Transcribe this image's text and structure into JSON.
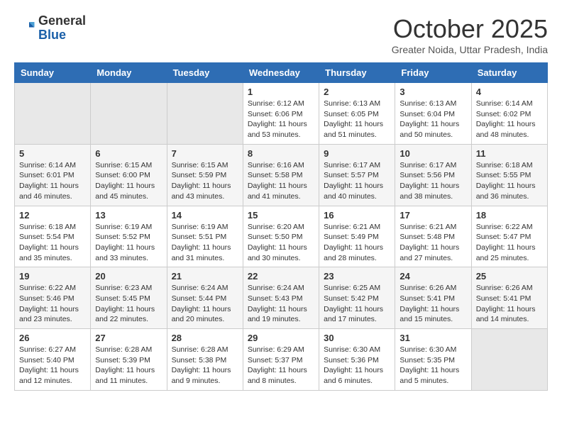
{
  "header": {
    "logo_general": "General",
    "logo_blue": "Blue",
    "month_title": "October 2025",
    "subtitle": "Greater Noida, Uttar Pradesh, India"
  },
  "days_of_week": [
    "Sunday",
    "Monday",
    "Tuesday",
    "Wednesday",
    "Thursday",
    "Friday",
    "Saturday"
  ],
  "weeks": [
    [
      {
        "day": "",
        "info": ""
      },
      {
        "day": "",
        "info": ""
      },
      {
        "day": "",
        "info": ""
      },
      {
        "day": "1",
        "info": "Sunrise: 6:12 AM\nSunset: 6:06 PM\nDaylight: 11 hours\nand 53 minutes."
      },
      {
        "day": "2",
        "info": "Sunrise: 6:13 AM\nSunset: 6:05 PM\nDaylight: 11 hours\nand 51 minutes."
      },
      {
        "day": "3",
        "info": "Sunrise: 6:13 AM\nSunset: 6:04 PM\nDaylight: 11 hours\nand 50 minutes."
      },
      {
        "day": "4",
        "info": "Sunrise: 6:14 AM\nSunset: 6:02 PM\nDaylight: 11 hours\nand 48 minutes."
      }
    ],
    [
      {
        "day": "5",
        "info": "Sunrise: 6:14 AM\nSunset: 6:01 PM\nDaylight: 11 hours\nand 46 minutes."
      },
      {
        "day": "6",
        "info": "Sunrise: 6:15 AM\nSunset: 6:00 PM\nDaylight: 11 hours\nand 45 minutes."
      },
      {
        "day": "7",
        "info": "Sunrise: 6:15 AM\nSunset: 5:59 PM\nDaylight: 11 hours\nand 43 minutes."
      },
      {
        "day": "8",
        "info": "Sunrise: 6:16 AM\nSunset: 5:58 PM\nDaylight: 11 hours\nand 41 minutes."
      },
      {
        "day": "9",
        "info": "Sunrise: 6:17 AM\nSunset: 5:57 PM\nDaylight: 11 hours\nand 40 minutes."
      },
      {
        "day": "10",
        "info": "Sunrise: 6:17 AM\nSunset: 5:56 PM\nDaylight: 11 hours\nand 38 minutes."
      },
      {
        "day": "11",
        "info": "Sunrise: 6:18 AM\nSunset: 5:55 PM\nDaylight: 11 hours\nand 36 minutes."
      }
    ],
    [
      {
        "day": "12",
        "info": "Sunrise: 6:18 AM\nSunset: 5:54 PM\nDaylight: 11 hours\nand 35 minutes."
      },
      {
        "day": "13",
        "info": "Sunrise: 6:19 AM\nSunset: 5:52 PM\nDaylight: 11 hours\nand 33 minutes."
      },
      {
        "day": "14",
        "info": "Sunrise: 6:19 AM\nSunset: 5:51 PM\nDaylight: 11 hours\nand 31 minutes."
      },
      {
        "day": "15",
        "info": "Sunrise: 6:20 AM\nSunset: 5:50 PM\nDaylight: 11 hours\nand 30 minutes."
      },
      {
        "day": "16",
        "info": "Sunrise: 6:21 AM\nSunset: 5:49 PM\nDaylight: 11 hours\nand 28 minutes."
      },
      {
        "day": "17",
        "info": "Sunrise: 6:21 AM\nSunset: 5:48 PM\nDaylight: 11 hours\nand 27 minutes."
      },
      {
        "day": "18",
        "info": "Sunrise: 6:22 AM\nSunset: 5:47 PM\nDaylight: 11 hours\nand 25 minutes."
      }
    ],
    [
      {
        "day": "19",
        "info": "Sunrise: 6:22 AM\nSunset: 5:46 PM\nDaylight: 11 hours\nand 23 minutes."
      },
      {
        "day": "20",
        "info": "Sunrise: 6:23 AM\nSunset: 5:45 PM\nDaylight: 11 hours\nand 22 minutes."
      },
      {
        "day": "21",
        "info": "Sunrise: 6:24 AM\nSunset: 5:44 PM\nDaylight: 11 hours\nand 20 minutes."
      },
      {
        "day": "22",
        "info": "Sunrise: 6:24 AM\nSunset: 5:43 PM\nDaylight: 11 hours\nand 19 minutes."
      },
      {
        "day": "23",
        "info": "Sunrise: 6:25 AM\nSunset: 5:42 PM\nDaylight: 11 hours\nand 17 minutes."
      },
      {
        "day": "24",
        "info": "Sunrise: 6:26 AM\nSunset: 5:41 PM\nDaylight: 11 hours\nand 15 minutes."
      },
      {
        "day": "25",
        "info": "Sunrise: 6:26 AM\nSunset: 5:41 PM\nDaylight: 11 hours\nand 14 minutes."
      }
    ],
    [
      {
        "day": "26",
        "info": "Sunrise: 6:27 AM\nSunset: 5:40 PM\nDaylight: 11 hours\nand 12 minutes."
      },
      {
        "day": "27",
        "info": "Sunrise: 6:28 AM\nSunset: 5:39 PM\nDaylight: 11 hours\nand 11 minutes."
      },
      {
        "day": "28",
        "info": "Sunrise: 6:28 AM\nSunset: 5:38 PM\nDaylight: 11 hours\nand 9 minutes."
      },
      {
        "day": "29",
        "info": "Sunrise: 6:29 AM\nSunset: 5:37 PM\nDaylight: 11 hours\nand 8 minutes."
      },
      {
        "day": "30",
        "info": "Sunrise: 6:30 AM\nSunset: 5:36 PM\nDaylight: 11 hours\nand 6 minutes."
      },
      {
        "day": "31",
        "info": "Sunrise: 6:30 AM\nSunset: 5:35 PM\nDaylight: 11 hours\nand 5 minutes."
      },
      {
        "day": "",
        "info": ""
      }
    ]
  ]
}
